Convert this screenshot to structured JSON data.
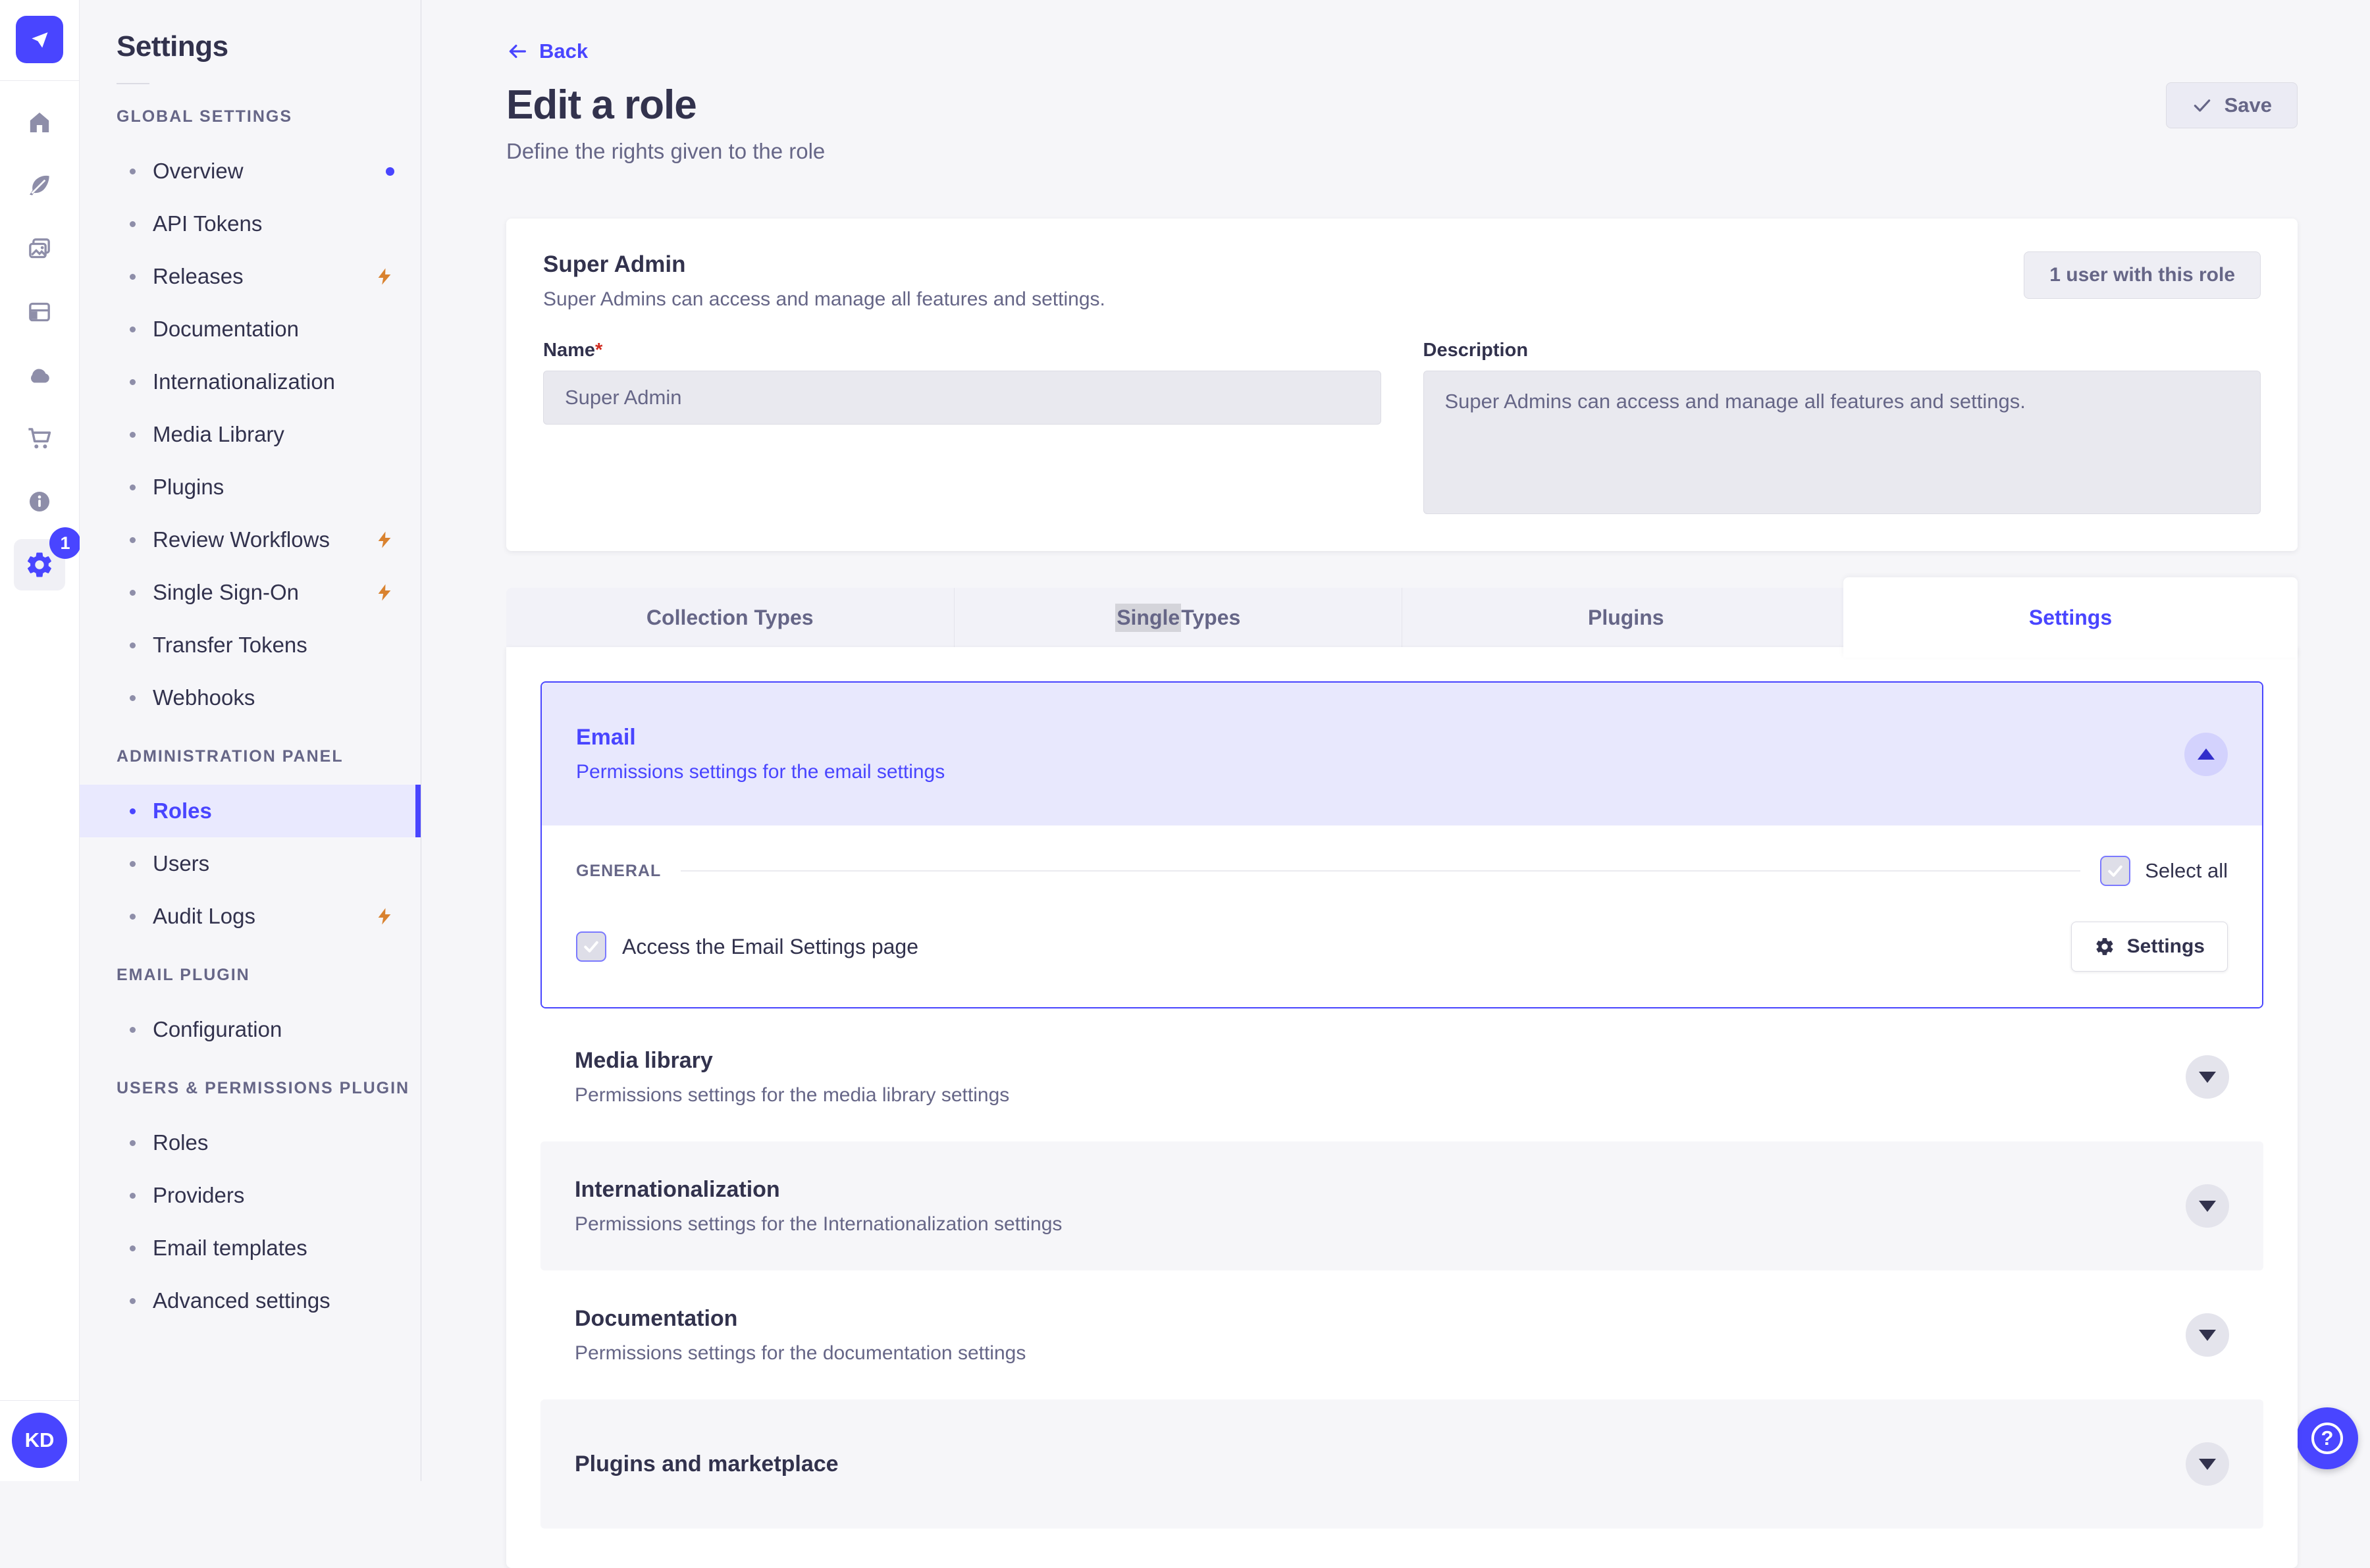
{
  "colors": {
    "primary": "#4945ff",
    "pageBg": "#f6f6f9",
    "textDark": "#32324d",
    "textGray": "#666687",
    "inputBg": "#e9e9ef",
    "btnGrayBg": "#ebebf4",
    "stripBg": "#f2f2f8",
    "selectionGray": "#d4d4da",
    "flash": "#d9822f",
    "danger": "#d02b20"
  },
  "icons": {
    "strapi-logo-icon": "paper-plane shape",
    "home-icon": "house",
    "content-manager-icon": "feather",
    "media-library-icon": "pictures",
    "content-type-builder-icon": "layout grid",
    "cloud-icon": "cloud",
    "marketplace-icon": "shopping cart",
    "info-icon": "info circle",
    "settings-icon": "gear",
    "flash-icon": "lightning bolt",
    "back-arrow-icon": "left arrow",
    "check-icon": "checkmark",
    "chevron-up-icon": "triangle up",
    "chevron-down-icon": "triangle down",
    "help-icon": "circled question mark"
  },
  "rail": {
    "settings_badge": "1",
    "avatar_initials": "KD"
  },
  "sidebar": {
    "title": "Settings",
    "sections": [
      {
        "heading": "GLOBAL SETTINGS",
        "items": [
          {
            "label": "Overview"
          },
          {
            "label": "API Tokens"
          },
          {
            "label": "Releases"
          },
          {
            "label": "Documentation"
          },
          {
            "label": "Internationalization"
          },
          {
            "label": "Media Library"
          },
          {
            "label": "Plugins"
          },
          {
            "label": "Review Workflows"
          },
          {
            "label": "Single Sign-On"
          },
          {
            "label": "Transfer Tokens"
          },
          {
            "label": "Webhooks"
          }
        ]
      },
      {
        "heading": "ADMINISTRATION PANEL",
        "items": [
          {
            "label": "Roles",
            "active": true
          },
          {
            "label": "Users"
          },
          {
            "label": "Audit Logs"
          }
        ]
      },
      {
        "heading": "EMAIL PLUGIN",
        "items": [
          {
            "label": "Configuration"
          }
        ]
      },
      {
        "heading": "USERS & PERMISSIONS PLUGIN",
        "items": [
          {
            "label": "Roles"
          },
          {
            "label": "Providers"
          },
          {
            "label": "Email templates"
          },
          {
            "label": "Advanced settings"
          }
        ]
      }
    ]
  },
  "header": {
    "back_label": "Back",
    "title": "Edit a role",
    "subtitle": "Define the rights given to the role",
    "save_label": "Save"
  },
  "role_card": {
    "title": "Super Admin",
    "subtitle": "Super Admins can access and manage all features and settings.",
    "users_button_label": "1 user with this role",
    "name_label": "Name",
    "name_required": "*",
    "name_value": "Super Admin",
    "description_label": "Description",
    "description_value": "Super Admins can access and manage all features and settings."
  },
  "tabs": {
    "items": [
      {
        "label": "Collection Types"
      },
      {
        "label": "Single Types",
        "selected_text": "Single",
        "rest_text": " Types"
      },
      {
        "label": "Plugins"
      },
      {
        "label": "Settings",
        "active": true
      }
    ]
  },
  "permissions": {
    "email": {
      "title": "Email",
      "subtitle": "Permissions settings for the email settings",
      "section_label": "GENERAL",
      "select_all_label": "Select all",
      "permission_label": "Access the Email Settings page",
      "settings_button_label": "Settings"
    },
    "accordions": [
      {
        "title": "Media library",
        "subtitle": "Permissions settings for the media library settings"
      },
      {
        "title": "Internationalization",
        "subtitle": "Permissions settings for the Internationalization settings"
      },
      {
        "title": "Documentation",
        "subtitle": "Permissions settings for the documentation settings"
      },
      {
        "title": "Plugins and marketplace"
      }
    ]
  },
  "help": {
    "label": "?"
  }
}
